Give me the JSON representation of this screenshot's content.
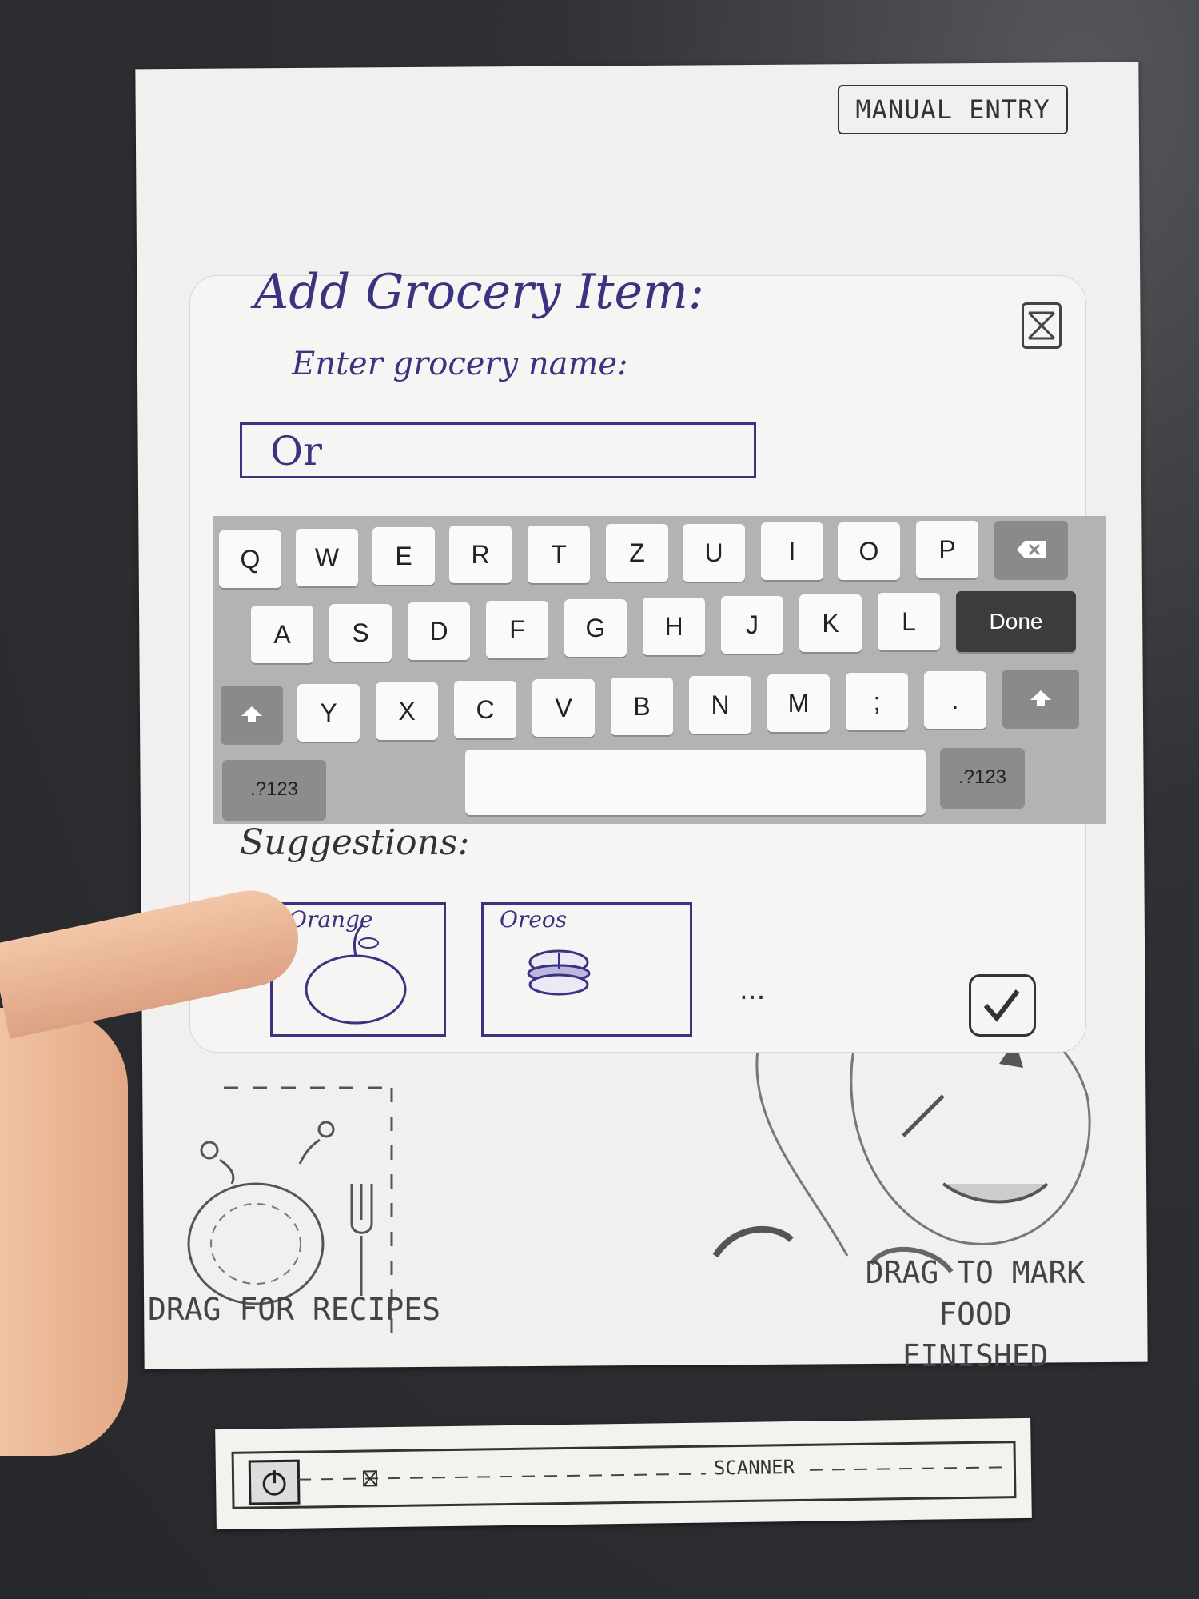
{
  "manual_entry": {
    "label": "MANUAL ENTRY"
  },
  "dialog": {
    "title": "Add Grocery Item:",
    "subtitle": "Enter grocery name:",
    "input_value": "Or",
    "suggestions_label": "Suggestions:",
    "suggestions": [
      {
        "name": "Orange",
        "icon": "orange-icon"
      },
      {
        "name": "Oreos",
        "icon": "oreos-icon"
      }
    ],
    "more": "..."
  },
  "keyboard": {
    "row1": [
      "Q",
      "W",
      "E",
      "R",
      "T",
      "Z",
      "U",
      "I",
      "O",
      "P"
    ],
    "row2": [
      "A",
      "S",
      "D",
      "F",
      "G",
      "H",
      "J",
      "K",
      "L"
    ],
    "row3": [
      "Y",
      "X",
      "C",
      "V",
      "B",
      "N",
      "M",
      ";",
      "."
    ],
    "done": "Done",
    "num_left": ".?123",
    "num_right": ".?123"
  },
  "recipes": {
    "label": "DRAG FOR RECIPES"
  },
  "finished": {
    "label_line1": "DRAG TO MARK FOOD",
    "label_line2": "FINISHED"
  },
  "scanner": {
    "label": "SCANNER"
  }
}
